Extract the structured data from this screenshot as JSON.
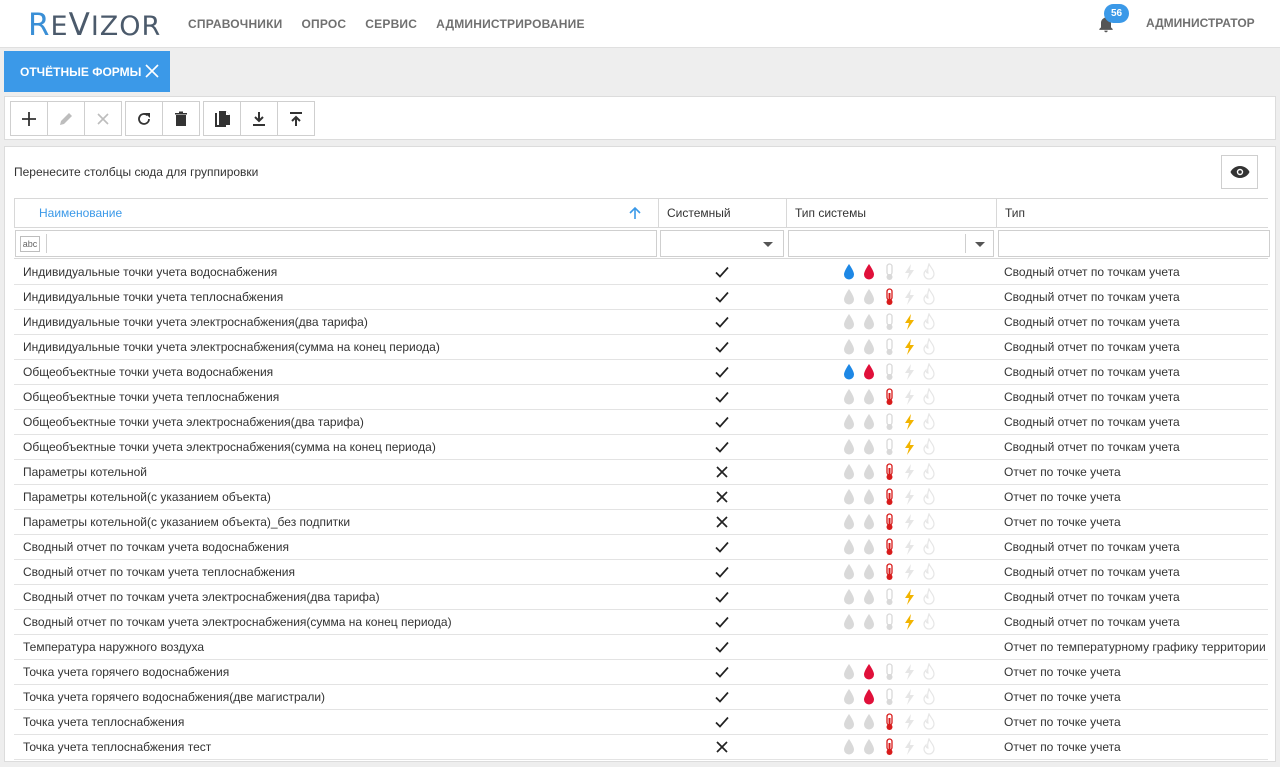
{
  "app": {
    "logo_first": "R",
    "logo_e": "E",
    "logo_v": "V",
    "logo_rest": "IZOR"
  },
  "nav": [
    "СПРАВОЧНИКИ",
    "ОПРОС",
    "СЕРВИС",
    "АДМИНИСТРИРОВАНИЕ"
  ],
  "notifications": {
    "count": "56"
  },
  "user": {
    "name": "АДМИНИСТРАТОР"
  },
  "tab": {
    "label": "ОТЧЁТНЫЕ ФОРМЫ"
  },
  "toolbar": {
    "buttons": [
      "add-icon",
      "edit-icon",
      "cancel-icon",
      "refresh-icon",
      "delete-icon",
      "copy-icon",
      "download-icon",
      "upload-icon"
    ]
  },
  "grid": {
    "group_hint": "Перенесите столбцы сюда для группировки",
    "columns": {
      "name": "Наименование",
      "system": "Системный",
      "system_type": "Тип системы",
      "type": "Тип"
    },
    "filter_abc": "abc",
    "colors": {
      "cold_water": "#1e88e5",
      "hot_water": "#e0103a",
      "heat": "#d81b1b",
      "power": "#f2b400",
      "inactive": "#d9d9d9",
      "accent": "#3b99e8"
    },
    "rows": [
      {
        "name": "Индивидуальные точки учета водоснабжения",
        "system": true,
        "icons": [
          1,
          1,
          0,
          0,
          0
        ],
        "type": "Сводный отчет по точкам учета"
      },
      {
        "name": "Индивидуальные точки учета теплоснабжения",
        "system": true,
        "icons": [
          0,
          0,
          1,
          0,
          0
        ],
        "type": "Сводный отчет по точкам учета"
      },
      {
        "name": "Индивидуальные точки учета электроснабжения(два тарифа)",
        "system": true,
        "icons": [
          0,
          0,
          0,
          1,
          0
        ],
        "type": "Сводный отчет по точкам учета"
      },
      {
        "name": "Индивидуальные точки учета электроснабжения(сумма на конец периода)",
        "system": true,
        "icons": [
          0,
          0,
          0,
          1,
          0
        ],
        "type": "Сводный отчет по точкам учета"
      },
      {
        "name": "Общеобъектные точки учета водоснабжения",
        "system": true,
        "icons": [
          1,
          1,
          0,
          0,
          0
        ],
        "type": "Сводный отчет по точкам учета"
      },
      {
        "name": "Общеобъектные точки учета теплоснабжения",
        "system": true,
        "icons": [
          0,
          0,
          1,
          0,
          0
        ],
        "type": "Сводный отчет по точкам учета"
      },
      {
        "name": "Общеобъектные точки учета электроснабжения(два тарифа)",
        "system": true,
        "icons": [
          0,
          0,
          0,
          1,
          0
        ],
        "type": "Сводный отчет по точкам учета"
      },
      {
        "name": "Общеобъектные точки учета электроснабжения(сумма на конец периода)",
        "system": true,
        "icons": [
          0,
          0,
          0,
          1,
          0
        ],
        "type": "Сводный отчет по точкам учета"
      },
      {
        "name": "Параметры котельной",
        "system": false,
        "icons": [
          0,
          0,
          1,
          0,
          0
        ],
        "type": "Отчет по точке учета"
      },
      {
        "name": "Параметры котельной(с указанием объекта)",
        "system": false,
        "icons": [
          0,
          0,
          1,
          0,
          0
        ],
        "type": "Отчет по точке учета"
      },
      {
        "name": "Параметры котельной(с указанием объекта)_без подпитки",
        "system": false,
        "icons": [
          0,
          0,
          1,
          0,
          0
        ],
        "type": "Отчет по точке учета"
      },
      {
        "name": "Сводный отчет по точкам учета водоснабжения",
        "system": true,
        "icons": [
          0,
          0,
          1,
          0,
          0
        ],
        "type": "Сводный отчет по точкам учета"
      },
      {
        "name": "Сводный отчет по точкам учета теплоснабжения",
        "system": true,
        "icons": [
          0,
          0,
          1,
          0,
          0
        ],
        "type": "Сводный отчет по точкам учета"
      },
      {
        "name": "Сводный отчет по точкам учета электроснабжения(два тарифа)",
        "system": true,
        "icons": [
          0,
          0,
          0,
          1,
          0
        ],
        "type": "Сводный отчет по точкам учета"
      },
      {
        "name": "Сводный отчет по точкам учета электроснабжения(сумма на конец периода)",
        "system": true,
        "icons": [
          0,
          0,
          0,
          1,
          0
        ],
        "type": "Сводный отчет по точкам учета"
      },
      {
        "name": "Температура наружного воздуха",
        "system": true,
        "icons": null,
        "type": "Отчет по температурному графику территории"
      },
      {
        "name": "Точка учета горячего водоснабжения",
        "system": true,
        "icons": [
          0,
          1,
          0,
          0,
          0
        ],
        "type": "Отчет по точке учета"
      },
      {
        "name": "Точка учета горячего водоснабжения(две магистрали)",
        "system": true,
        "icons": [
          0,
          1,
          0,
          0,
          0
        ],
        "type": "Отчет по точке учета"
      },
      {
        "name": "Точка учета теплоснабжения",
        "system": true,
        "icons": [
          0,
          0,
          1,
          0,
          0
        ],
        "type": "Отчет по точке учета"
      },
      {
        "name": "Точка учета теплоснабжения тест",
        "system": false,
        "icons": [
          0,
          0,
          1,
          0,
          0
        ],
        "type": "Отчет по точке учета"
      }
    ]
  }
}
